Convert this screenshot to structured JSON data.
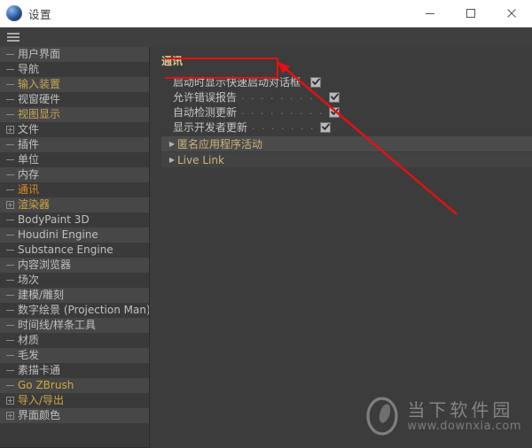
{
  "window": {
    "title": "设置",
    "icon": "c4d-orb-icon",
    "controls": {
      "minimize": "minimize-icon",
      "maximize": "maximize-icon",
      "close": "close-icon"
    }
  },
  "menubar": {
    "hamburger": "hamburger-menu-icon"
  },
  "sidebar": {
    "items": [
      {
        "label": "用户界面",
        "glyph": "dash",
        "color": "gray",
        "indent": 1
      },
      {
        "label": "导航",
        "glyph": "dash",
        "color": "gray",
        "indent": 1
      },
      {
        "label": "输入装置",
        "glyph": "dash",
        "color": "amber",
        "indent": 1
      },
      {
        "label": "视窗硬件",
        "glyph": "dash",
        "color": "gray",
        "indent": 1
      },
      {
        "label": "视图显示",
        "glyph": "dash",
        "color": "amber",
        "indent": 1
      },
      {
        "label": "文件",
        "glyph": "box",
        "color": "gray",
        "indent": 0
      },
      {
        "label": "插件",
        "glyph": "dash",
        "color": "gray",
        "indent": 1
      },
      {
        "label": "单位",
        "glyph": "dash",
        "color": "gray",
        "indent": 1
      },
      {
        "label": "内存",
        "glyph": "dash",
        "color": "gray",
        "indent": 1
      },
      {
        "label": "通讯",
        "glyph": "dash",
        "color": "orange",
        "indent": 1
      },
      {
        "label": "渲染器",
        "glyph": "box",
        "color": "gold",
        "indent": 0
      },
      {
        "label": "BodyPaint 3D",
        "glyph": "dash",
        "color": "gray",
        "indent": 1
      },
      {
        "label": "Houdini Engine",
        "glyph": "dash",
        "color": "gray",
        "indent": 1
      },
      {
        "label": "Substance Engine",
        "glyph": "dash",
        "color": "gray",
        "indent": 1
      },
      {
        "label": "内容浏览器",
        "glyph": "dash",
        "color": "gray",
        "indent": 1
      },
      {
        "label": "场次",
        "glyph": "dash",
        "color": "gray",
        "indent": 1
      },
      {
        "label": "建模/雕刻",
        "glyph": "dash",
        "color": "gray",
        "indent": 1
      },
      {
        "label": "数字绘景 (Projection Man)",
        "glyph": "dash",
        "color": "gray",
        "indent": 1
      },
      {
        "label": "时间线/样条工具",
        "glyph": "dash",
        "color": "gray",
        "indent": 1
      },
      {
        "label": "材质",
        "glyph": "dash",
        "color": "gray",
        "indent": 1
      },
      {
        "label": "毛发",
        "glyph": "dash",
        "color": "gray",
        "indent": 1
      },
      {
        "label": "素描卡通",
        "glyph": "dash",
        "color": "gray",
        "indent": 1
      },
      {
        "label": "Go ZBrush",
        "glyph": "dash",
        "color": "gold",
        "indent": 1
      },
      {
        "label": "导入/导出",
        "glyph": "box",
        "color": "gold",
        "indent": 0
      },
      {
        "label": "界面颜色",
        "glyph": "box",
        "color": "gray",
        "indent": 0
      }
    ]
  },
  "main": {
    "section_title": "通讯",
    "options": [
      {
        "label": "启动时显示快速启动对话框",
        "checked": true,
        "leader": ""
      },
      {
        "label": "允许错误报告",
        "checked": true,
        "leader": ". . . . . . . . ."
      },
      {
        "label": "自动检测更新",
        "checked": true,
        "leader": ". . . . . . . . ."
      },
      {
        "label": "显示开发者更新",
        "checked": true,
        "leader": ". . . . . . ."
      }
    ],
    "groups": [
      {
        "label": "匿名应用程序活动",
        "expanded": false
      },
      {
        "label": "Live Link",
        "expanded": false
      }
    ]
  },
  "annotation": {
    "color": "#e81010",
    "type": "highlight-box-with-arrow",
    "target": "启动时显示快速启动对话框"
  },
  "watermark": {
    "name": "当下软件园",
    "url": "www.downxia.com"
  }
}
